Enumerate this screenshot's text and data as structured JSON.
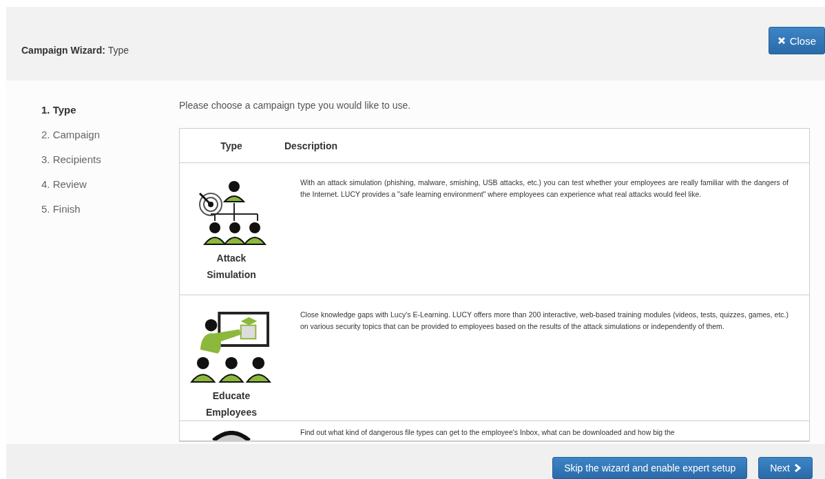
{
  "header": {
    "title_bold": "Campaign Wizard:",
    "title_step": "Type",
    "close_button": "Close"
  },
  "steps": [
    {
      "label": "1. Type",
      "selected": true
    },
    {
      "label": "2. Campaign",
      "selected": false
    },
    {
      "label": "3. Recipients",
      "selected": false
    },
    {
      "label": "4. Review",
      "selected": false
    },
    {
      "label": "5. Finish",
      "selected": false
    }
  ],
  "intro": "Please choose a campaign type you would like to use.",
  "table": {
    "columns": [
      "Type",
      "Description"
    ],
    "rows": [
      {
        "kind": "attack",
        "type": "Attack Simulation",
        "description": "With an attack simulation (phishing, malware, smishing, USB attacks, etc.) you can test whether your employees are really familiar with the dangers of the Internet. LUCY provides a \"safe learning environment\" where employees can experience what real attacks would feel like."
      },
      {
        "kind": "educate",
        "type": "Educate Employees",
        "description": "Close knowledge gaps with Lucy's E-Learning. LUCY offers more than 200 interactive, web-based training modules (videos, tests, quizzes, games, etc.) on various security topics that can be provided to employees based on the results of the attack simulations or independently of them."
      },
      {
        "kind": "file",
        "description": "Find out what kind of dangerous file types can get to the employee's Inbox, what can be downloaded and how big the"
      }
    ]
  },
  "footer": {
    "skip_button": "Skip the wizard and enable expert setup",
    "next_button": "Next"
  }
}
